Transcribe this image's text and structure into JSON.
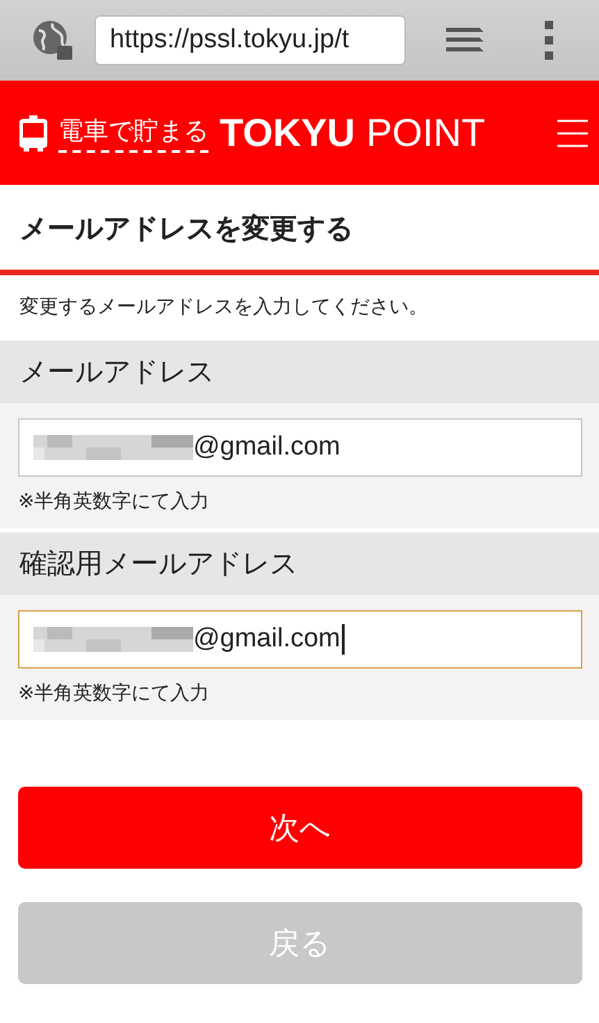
{
  "browser": {
    "url": "https://pssl.tokyu.jp/t"
  },
  "header": {
    "tagline": "電車で貯まる",
    "brand_bold": "TOKYU",
    "brand_light": "POINT"
  },
  "page_title": "メールアドレスを変更する",
  "instruction": "変更するメールアドレスを入力してください。",
  "fields": [
    {
      "label": "メールアドレス",
      "value": "@gmail.com",
      "focused": false,
      "note": "※半角英数字にて入力"
    },
    {
      "label": "確認用メールアドレス",
      "value": "@gmail.com",
      "focused": true,
      "note": "※半角英数字にて入力"
    }
  ],
  "buttons": [
    {
      "label": "次へ",
      "disabled": false
    },
    {
      "label": "戻る",
      "disabled": true
    }
  ]
}
